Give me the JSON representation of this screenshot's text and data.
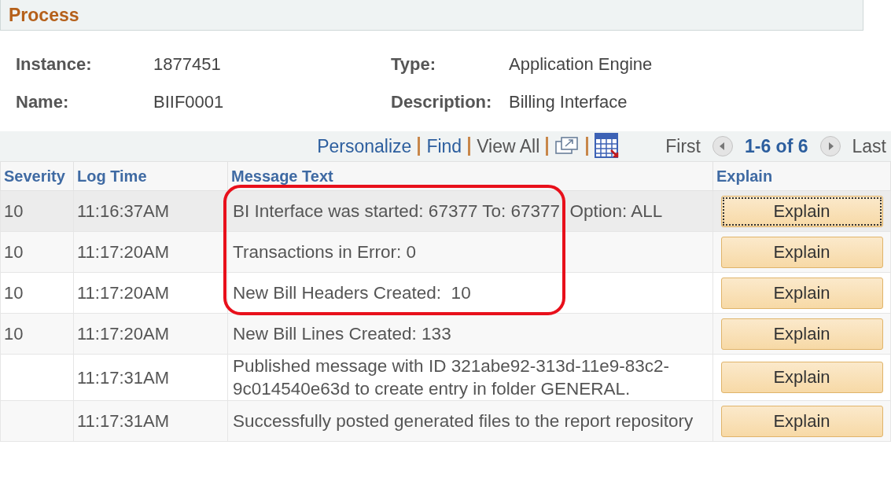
{
  "section": {
    "title": "Process"
  },
  "fields": [
    {
      "label": "Instance:",
      "value": "1877451"
    },
    {
      "label": "Type:",
      "value": "Application Engine"
    },
    {
      "label": "Name:",
      "value": "BIIF0001"
    },
    {
      "label": "Description:",
      "value": "Billing Interface"
    }
  ],
  "toolbar": {
    "links": [
      {
        "label": "Personalize",
        "kind": "link"
      },
      {
        "label": "Find",
        "kind": "link"
      },
      {
        "label": "View All",
        "kind": "text"
      }
    ],
    "first": "First",
    "range": "1-6 of 6",
    "last": "Last"
  },
  "table": {
    "columns": [
      "Severity",
      "Log Time",
      "Message Text",
      "Explain"
    ],
    "rows": [
      {
        "severity": "10",
        "time": "11:16:37AM",
        "message": "BI Interface was started: 67377 To: 67377  Option: ALL",
        "button": "Explain",
        "selected": true,
        "highlighted": true
      },
      {
        "severity": "10",
        "time": "11:17:20AM",
        "message": "Transactions in Error: 0",
        "button": "Explain",
        "selected": false,
        "highlighted": true
      },
      {
        "severity": "10",
        "time": "11:17:20AM",
        "message": "New Bill Headers Created:  10",
        "button": "Explain",
        "selected": false,
        "highlighted": true
      },
      {
        "severity": "10",
        "time": "11:17:20AM",
        "message": "New Bill Lines Created: 133",
        "button": "Explain",
        "selected": false,
        "highlighted": false
      },
      {
        "time": "11:17:31AM",
        "message": "Published message with ID 321abe92-313d-11e9-83c2-9c014540e63d to create entry in folder GENERAL.",
        "button": "Explain",
        "selected": false,
        "highlighted": false
      },
      {
        "time": "11:17:31AM",
        "message": "Successfully posted generated files to the report repository",
        "button": "Explain",
        "selected": false,
        "highlighted": false
      }
    ]
  }
}
